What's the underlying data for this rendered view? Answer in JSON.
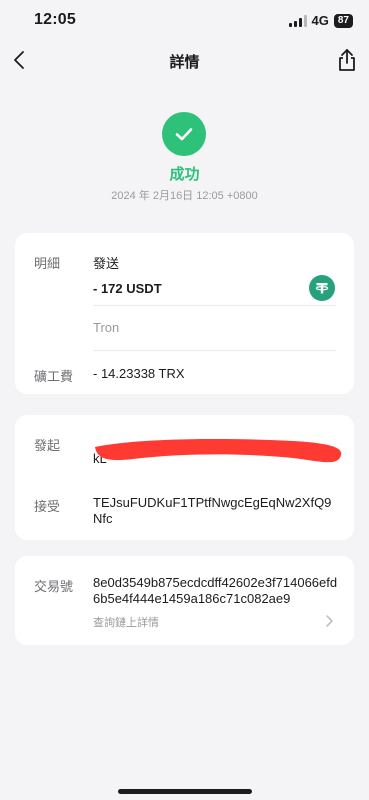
{
  "status_bar": {
    "time": "12:05",
    "network": "4G",
    "battery": "87"
  },
  "nav": {
    "title": "詳情",
    "back_icon": "chevron-left-icon",
    "share_icon": "share-icon"
  },
  "transaction": {
    "status": "成功",
    "datetime": "2024 年 2月16日 12:05 +0800",
    "status_color": "#2ec17a"
  },
  "details_card": {
    "detail_label": "明細",
    "type": "發送",
    "amount": "- 172 USDT",
    "token_icon": "tether-usdt-icon",
    "network": "Tron",
    "fee_label": "礦工費",
    "fee": "- 14.23338 TRX"
  },
  "address_card": {
    "from_label": "發起",
    "from_value_visible": "kL",
    "to_label": "接受",
    "to_value": "TEJsuFUDKuF1TPtfNwgcEgEqNw2XfQ9Nfc"
  },
  "hash_card": {
    "hash_label": "交易號",
    "hash_value": "8e0d3549b875ecdcdff42602e3f714066efd6b5e4f444e1459a186c71c082ae9",
    "explorer_link": "查詢鏈上詳情"
  },
  "colors": {
    "success": "#2ec17a",
    "tether": "#26a17b",
    "redaction": "#ff3a33",
    "background": "#f4f4f6"
  }
}
